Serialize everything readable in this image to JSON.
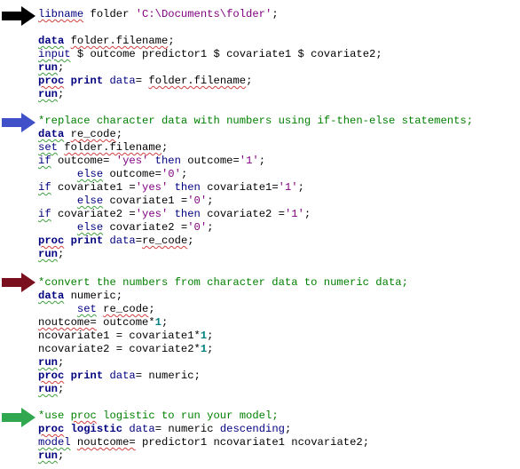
{
  "arrows": {
    "black": "#000000",
    "blue": "#4050c8",
    "maroon": "#7a0f1e",
    "green": "#30a850"
  },
  "code": {
    "b1": {
      "l1": {
        "kw": "libname",
        "rest": " folder ",
        "str": "'C:\\Documents\\folder'",
        "end": ";"
      },
      "l2": {
        "kw": "data",
        "sp": " ",
        "name": "folder.filename",
        "end": ";"
      },
      "l3": {
        "kw": "input",
        "rest": " $ outcome predictor1 $ covariate1 $ covariate2;"
      },
      "l4": {
        "kw": "run",
        "end": ";"
      },
      "l5": {
        "kw": "proc",
        "sp": " ",
        "kw2": "print",
        "opt": " data",
        "rest": "= ",
        "name": "folder.filename",
        "end": ";"
      },
      "l6": {
        "kw": "run",
        "end": ";"
      }
    },
    "b2": {
      "comment": "*replace character data with numbers using if-then-else statements;",
      "l1": {
        "kw": "data",
        "sp": " ",
        "name": "re_code",
        "end": ";"
      },
      "l2": {
        "kw": "set",
        "sp": " ",
        "name": "folder.filename",
        "end": ";"
      },
      "l3": {
        "kw": "if",
        "a": " outcome= ",
        "str": "'yes'",
        "then": " then",
        "b": " outcome=",
        "str2": "'1'",
        "end": ";"
      },
      "l4": {
        "indent": "      ",
        "kw": "else",
        "a": " outcome=",
        "str": "'0'",
        "end": ";"
      },
      "l5": {
        "kw": "if",
        "a": " covariate1 =",
        "str": "'yes'",
        "then": " then",
        "b": " covariate1=",
        "str2": "'1'",
        "end": ";"
      },
      "l6": {
        "indent": "      ",
        "kw": "else",
        "a": " covariate1 =",
        "str": "'0'",
        "end": ";"
      },
      "l7": {
        "kw": "if",
        "a": " covariate2 =",
        "str": "'yes'",
        "then": " then",
        "b": " covariate2 =",
        "str2": "'1'",
        "end": ";"
      },
      "l8": {
        "indent": "      ",
        "kw": "else",
        "a": " covariate2 =",
        "str": "'0'",
        "end": ";"
      },
      "l9": {
        "kw": "proc",
        "sp": " ",
        "kw2": "print",
        "opt": " data",
        "rest": "=",
        "name": "re_code",
        "end": ";"
      },
      "l10": {
        "kw": "run",
        "end": ";"
      }
    },
    "b3": {
      "comment": "*convert the numbers from character data to numeric data;",
      "l1": {
        "kw": "data",
        "rest": " numeric;"
      },
      "l2": {
        "indent": "      ",
        "kw": "set",
        "sp": " ",
        "name": "re_code",
        "end": ";"
      },
      "l3": {
        "name": "noutcome=",
        "rest": " outcome*",
        "num": "1",
        "end": ";"
      },
      "l4": {
        "rest": "ncovariate1 = covariate1*",
        "num": "1",
        "end": ";"
      },
      "l5": {
        "rest": "ncovariate2 = covariate2*",
        "num": "1",
        "end": ";"
      },
      "l6": {
        "kw": "run",
        "end": ";"
      },
      "l7": {
        "kw": "proc",
        "sp": " ",
        "kw2": "print",
        "opt": " data",
        "rest": "= numeric;"
      },
      "l8": {
        "kw": "run",
        "end": ";"
      }
    },
    "b4": {
      "comment_a": "*use ",
      "comment_proc": "proc",
      "comment_b": " logistic to run your model;",
      "l1": {
        "kw": "proc",
        "sp": " ",
        "kw2": "logistic",
        "opt": " data",
        "rest": "= numeric ",
        "opt2": "descending",
        "end": ";"
      },
      "l2": {
        "kw": "model",
        "sp": " ",
        "name": "noutcome=",
        "rest": " predictor1 ncovariate1 ncovariate2;"
      },
      "l3": {
        "kw": "run",
        "end": ";"
      }
    }
  }
}
